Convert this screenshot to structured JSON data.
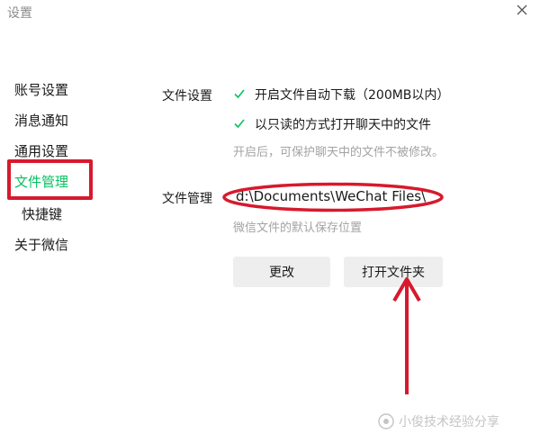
{
  "window": {
    "title": "设置"
  },
  "sidebar": {
    "items": [
      {
        "label": "账号设置"
      },
      {
        "label": "消息通知"
      },
      {
        "label": "通用设置"
      },
      {
        "label": "文件管理"
      },
      {
        "label": "快捷键"
      },
      {
        "label": "关于微信"
      }
    ],
    "active": "文件管理"
  },
  "file_settings": {
    "label": "文件设置",
    "auto_download": {
      "label": "开启文件自动下载（200MB以内）",
      "checked": true
    },
    "readonly_open": {
      "label": "以只读的方式打开聊天中的文件",
      "checked": true
    },
    "hint": "开启后，可保护聊天中的文件不被修改。"
  },
  "file_management": {
    "label": "文件管理",
    "path": "d:\\Documents\\WeChat Files\\",
    "hint": "微信文件的默认保存位置"
  },
  "buttons": {
    "change": "更改",
    "open_folder": "打开文件夹"
  },
  "colors": {
    "accent": "#07c160",
    "annotation_red": "#d7192d"
  },
  "watermark": {
    "text": "小俊技术经验分享"
  }
}
